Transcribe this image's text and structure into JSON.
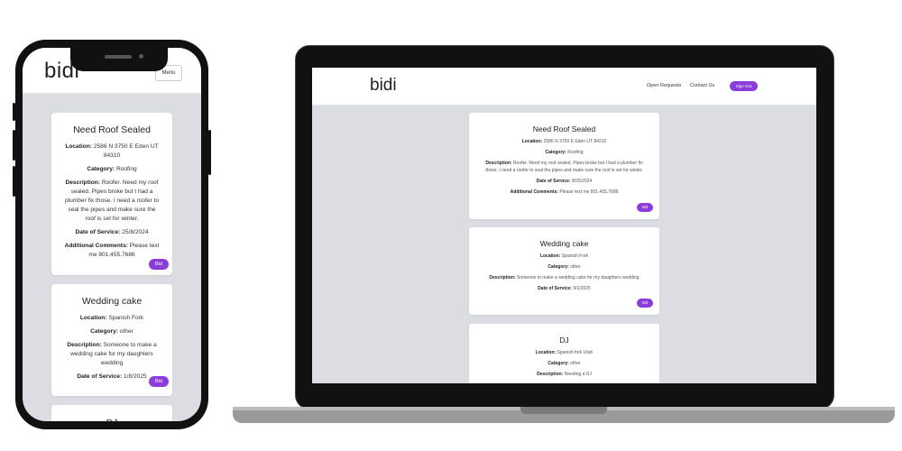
{
  "brand": "bidi",
  "phone_header": {
    "menu_label": "Menu"
  },
  "laptop_nav": {
    "open_requests": "Open Requests",
    "contact_us": "Contact Us",
    "sign_out": "Sign Out"
  },
  "labels": {
    "location": "Location:",
    "category": "Category:",
    "description": "Description:",
    "date": "Date of Service:",
    "comments": "Additional Comments:",
    "bid": "Bid"
  },
  "phone_cards": [
    {
      "title": "Need Roof Sealed",
      "location": "2586 N 3750 E Eden UT 84310",
      "category": "Roofing",
      "description": "Roofer. Need my roof sealed. Pipes broke but I had a plumber fix those. I need a roofer to seal the pipes and make sure the roof is set for winter.",
      "date": "25/8/2024",
      "comments": "Please text me 801.455.7686"
    },
    {
      "title": "Wedding cake",
      "location": "Spanish Fork",
      "category": "other",
      "description": "Someone to make a wedding cake for my daughters wedding",
      "date": "1/8/2025"
    },
    {
      "title": "DJ"
    }
  ],
  "laptop_cards": [
    {
      "title": "Need Roof Sealed",
      "location": "2586 N 3750 E Eden UT 84310",
      "category": "Roofing",
      "description": "Roofer. Need my roof sealed. Pipes broke but I had a plumber fix those. I need a roofer to seal the pipes and make sure the roof is set for winter.",
      "date": "8/25/2024",
      "comments": "Please text me 801.455.7686"
    },
    {
      "title": "Wedding cake",
      "location": "Spanish Fork",
      "category": "other",
      "description": "Someone to make a wedding cake for my daughters wedding",
      "date": "8/1/2025"
    },
    {
      "title": "DJ",
      "location": "Spanish fork Utah",
      "category": "other",
      "description": "Needing a DJ"
    }
  ],
  "colors": {
    "accent": "#8b3dd9",
    "page_bg": "#dcdde2",
    "device": "#111111"
  }
}
